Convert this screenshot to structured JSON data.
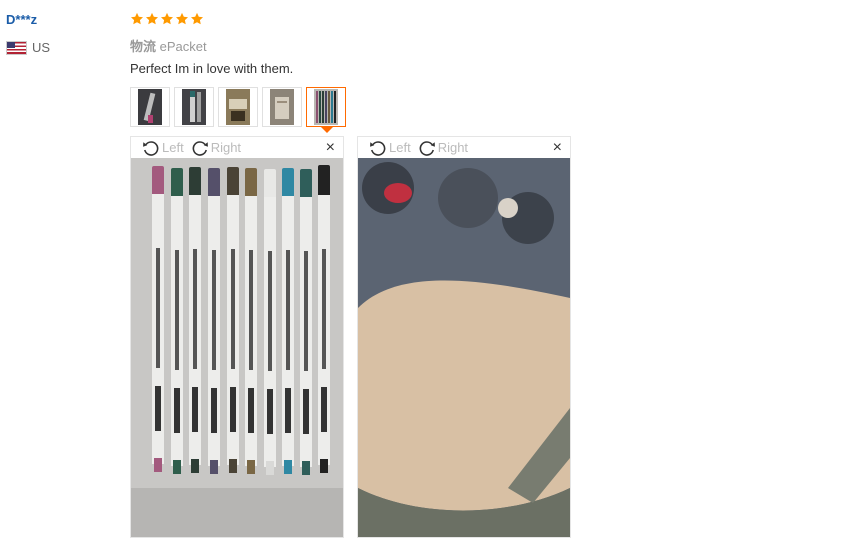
{
  "review": {
    "user_name": "D***z",
    "country": "US",
    "stars": 5,
    "star_color": "#ff9a00",
    "logistics_label": "物流",
    "logistics_value": "ePacket",
    "feedback_text": "Perfect Im in love with them."
  },
  "thumbnails": [
    {
      "active": false
    },
    {
      "active": false
    },
    {
      "active": false
    },
    {
      "active": false
    },
    {
      "active": true
    }
  ],
  "viewer": {
    "left_label": "Left",
    "right_label": "Right",
    "close_glyph": "×"
  },
  "icons": [
    "us-flag-icon",
    "star-icon",
    "rotate-left-icon",
    "rotate-right-icon",
    "close-icon"
  ],
  "colors": {
    "accent": "#ff6a00",
    "user_link": "#1a5ca8"
  }
}
